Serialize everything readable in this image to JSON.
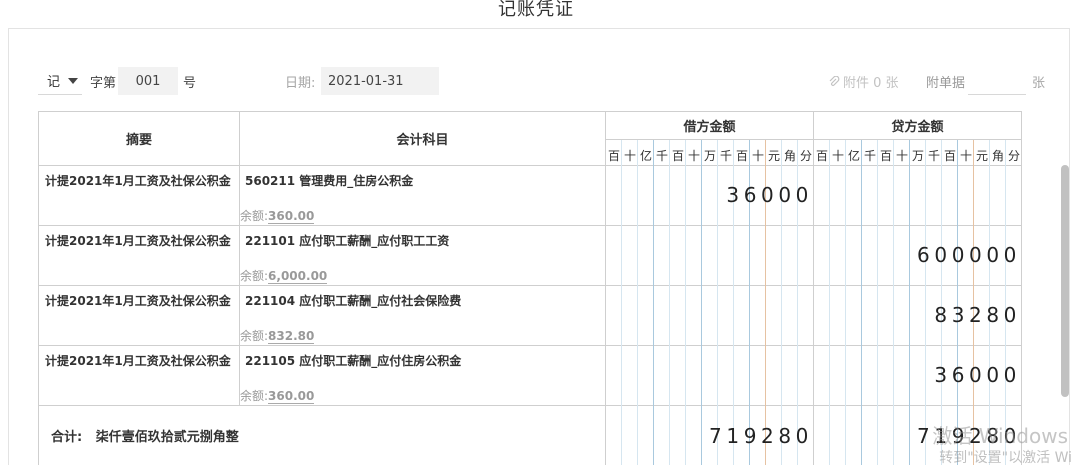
{
  "title": "记账凭证",
  "header": {
    "voucher_type": "记",
    "word_label": "字第",
    "voucher_no": "001",
    "number_label": "号",
    "date_label": "日期:",
    "date_value": "2021-01-31",
    "attachment_text": "附件 0 张",
    "attach_label": "附单据",
    "sheets_label": "张"
  },
  "table": {
    "summary_header": "摘要",
    "account_header": "会计科目",
    "debit_header": "借方金额",
    "credit_header": "贷方金额",
    "units": [
      "百",
      "十",
      "亿",
      "千",
      "百",
      "十",
      "万",
      "千",
      "百",
      "十",
      "元",
      "角",
      "分"
    ],
    "balance_label": "余额:",
    "rows": [
      {
        "summary": "计提2021年1月工资及社保公积金",
        "account": "560211 管理费用_住房公积金",
        "balance": "360.00",
        "debit": "36000",
        "credit": ""
      },
      {
        "summary": "计提2021年1月工资及社保公积金",
        "account": "221101 应付职工薪酬_应付职工工资",
        "balance": "6,000.00",
        "debit": "",
        "credit": "600000"
      },
      {
        "summary": "计提2021年1月工资及社保公积金",
        "account": "221104 应付职工薪酬_应付社会保险费",
        "balance": "832.80",
        "debit": "",
        "credit": "83280"
      },
      {
        "summary": "计提2021年1月工资及社保公积金",
        "account": "221105 应付职工薪酬_应付住房公积金",
        "balance": "360.00",
        "debit": "",
        "credit": "36000"
      }
    ],
    "total_label": "合计:",
    "total_words": "柒仟壹佰玖拾贰元捌角整",
    "total_debit": "719280",
    "total_credit": "719280"
  },
  "watermark": {
    "line1": "激活 Windows",
    "line2": "转到\"设置\"以激活 Wi"
  }
}
